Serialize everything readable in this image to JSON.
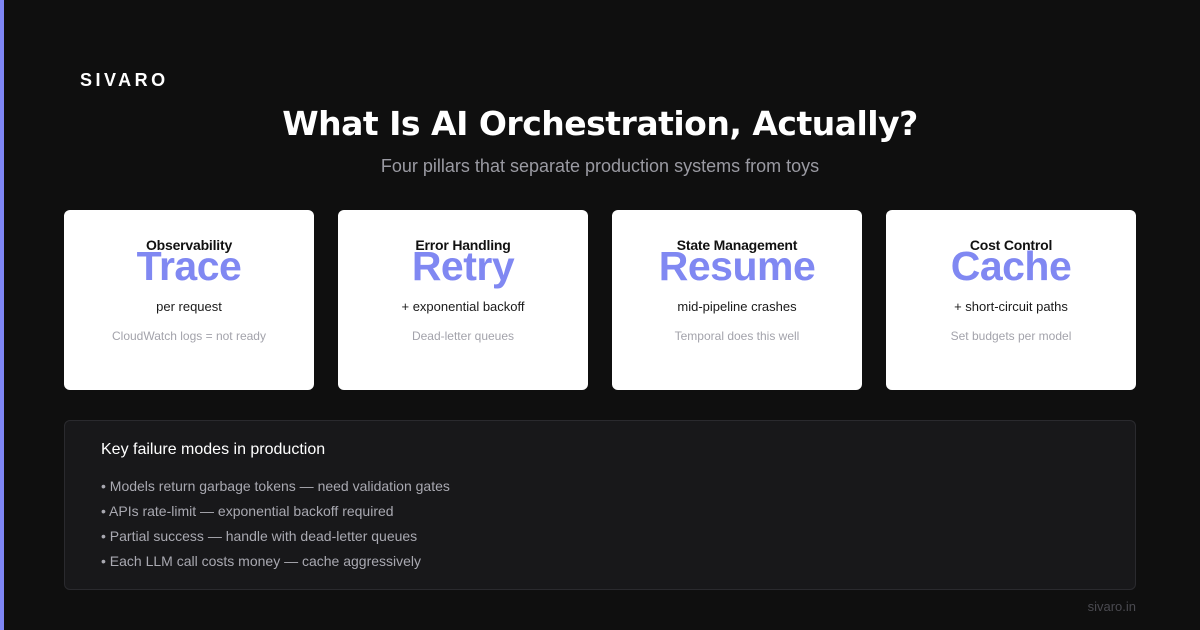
{
  "brand": {
    "name": "SIVARO"
  },
  "header": {
    "title": "What Is AI Orchestration, Actually?",
    "subtitle": "Four pillars that separate production systems from toys"
  },
  "pillars": [
    {
      "label": "Observability",
      "keyword": "Trace",
      "detail": "per request",
      "note": "CloudWatch logs = not ready"
    },
    {
      "label": "Error Handling",
      "keyword": "Retry",
      "detail": "+ exponential backoff",
      "note": "Dead-letter queues"
    },
    {
      "label": "State Management",
      "keyword": "Resume",
      "detail": "mid-pipeline crashes",
      "note": "Temporal does this well"
    },
    {
      "label": "Cost Control",
      "keyword": "Cache",
      "detail": "+ short-circuit paths",
      "note": "Set budgets per model"
    }
  ],
  "failures": {
    "heading": "Key failure modes in production",
    "items": [
      "• Models return garbage tokens — need validation gates",
      "• APIs rate-limit — exponential backoff required",
      "• Partial success — handle with dead-letter queues",
      "• Each LLM call costs money — cache aggressively"
    ]
  },
  "footer": {
    "site": "sivaro.in"
  },
  "colors": {
    "accent": "#7f86f5",
    "background": "#0f0f0f",
    "card": "#ffffff",
    "panel": "#18181a"
  }
}
